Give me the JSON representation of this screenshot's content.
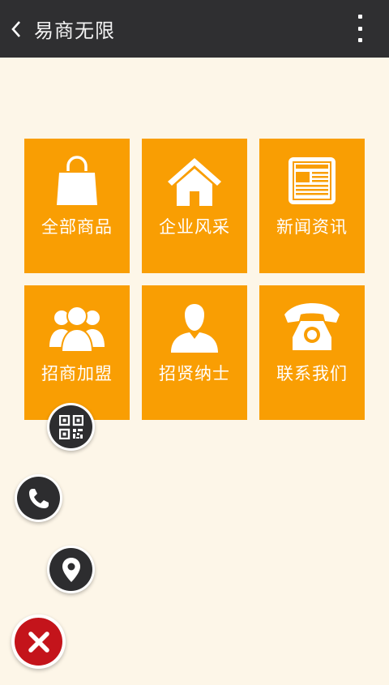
{
  "header": {
    "title": "易商无限",
    "back_icon": "chevron-left-icon",
    "menu_icon": "more-vertical-icon"
  },
  "tiles": [
    {
      "label": "全部商品",
      "icon": "shopping-bag-icon"
    },
    {
      "label": "企业风采",
      "icon": "home-icon"
    },
    {
      "label": "新闻资讯",
      "icon": "newspaper-icon"
    },
    {
      "label": "招商加盟",
      "icon": "group-icon"
    },
    {
      "label": "招贤纳士",
      "icon": "person-icon"
    },
    {
      "label": "联系我们",
      "icon": "telephone-icon"
    }
  ],
  "floating_menu": {
    "items": [
      "qr-code-icon",
      "phone-icon",
      "location-pin-icon"
    ],
    "close_icon": "close-icon"
  },
  "colors": {
    "header_bg": "#2f2f31",
    "page_bg": "#fdf6e8",
    "tile_bg": "#f99e03",
    "close_bg": "#c4141b"
  }
}
